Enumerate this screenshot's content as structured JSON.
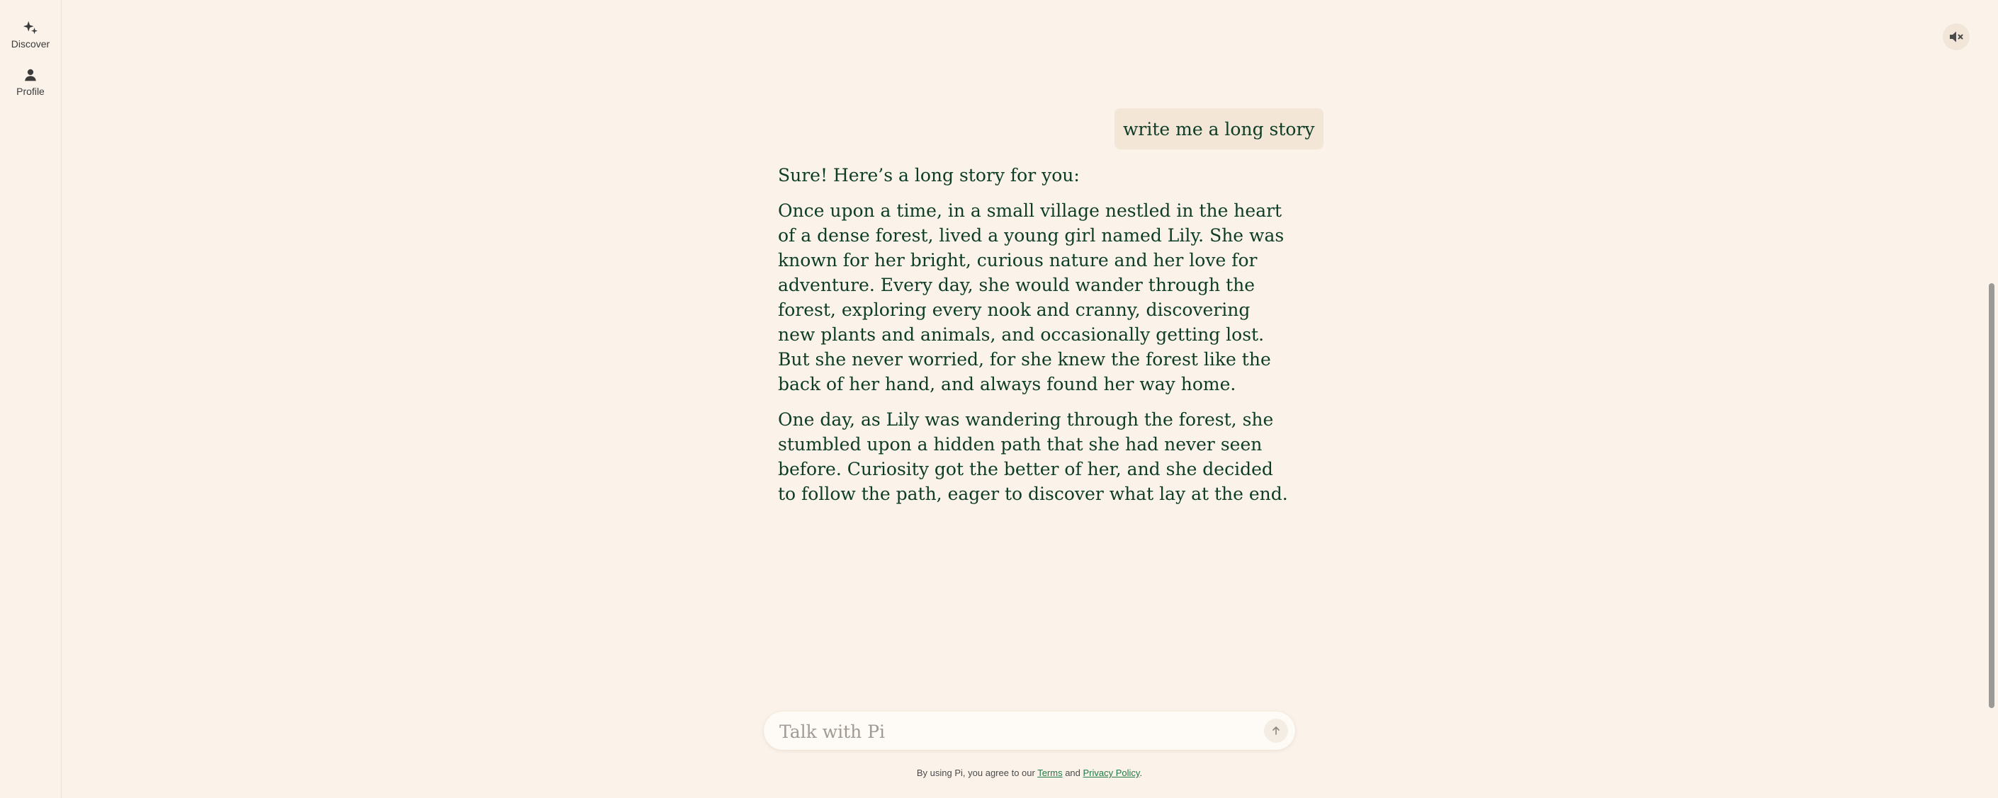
{
  "sidebar": {
    "items": [
      {
        "label": "Discover",
        "icon": "sparkle-icon"
      },
      {
        "label": "Profile",
        "icon": "person-icon"
      }
    ]
  },
  "header": {
    "mute_icon": "speaker-muted-icon"
  },
  "conversation": {
    "user_message": "write me a long story",
    "response": [
      "Sure! Here’s a long story for you:",
      "Once upon a time, in a small village nestled in the heart of a dense forest, lived a young girl named Lily. She was known for her bright, curious nature and her love for adventure. Every day, she would wander through the forest, exploring every nook and cranny, discovering new plants and animals, and occasionally getting lost. But she never worried, for she knew the forest like the back of her hand, and always found her way home.",
      "One day, as Lily was wandering through the forest, she stumbled upon a hidden path that she had never seen before. Curiosity got the better of her, and she decided to follow the path, eager to discover what lay at the end."
    ]
  },
  "composer": {
    "placeholder": "Talk with Pi",
    "value": "",
    "send_icon": "arrow-up-icon"
  },
  "footer": {
    "prefix": "By using Pi, you agree to our ",
    "terms": "Terms",
    "and": " and ",
    "privacy": "Privacy Policy",
    "suffix": "."
  },
  "colors": {
    "background": "#FBF3EA",
    "text": "#0D3C26",
    "user_bubble": "#F3E6D6",
    "link": "#1F7A45"
  }
}
